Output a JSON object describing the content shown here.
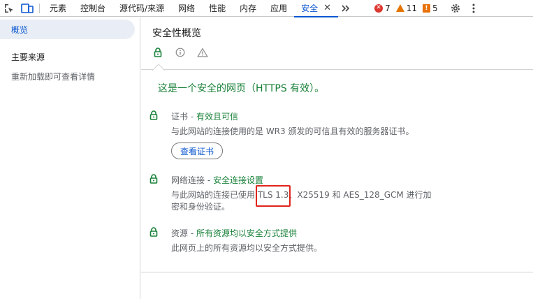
{
  "tabs": [
    {
      "label": "元素",
      "active": false
    },
    {
      "label": "控制台",
      "active": false
    },
    {
      "label": "源代码/来源",
      "active": false
    },
    {
      "label": "网络",
      "active": false
    },
    {
      "label": "性能",
      "active": false
    },
    {
      "label": "内存",
      "active": false
    },
    {
      "label": "应用",
      "active": false
    },
    {
      "label": "安全",
      "active": true
    }
  ],
  "counters": {
    "errors": "7",
    "warnings": "11",
    "issues": "5"
  },
  "icons": {
    "inspect": "inspect-element-icon",
    "device": "device-toolbar-icon",
    "more_tabs": "chevron-double-right-icon",
    "close": "close-icon",
    "settings": "gear-icon",
    "menu": "kebab-menu-icon",
    "lock": "lock-icon",
    "info": "info-icon",
    "warning": "warning-icon"
  },
  "sidebar": {
    "overview": "概览",
    "main_origin_heading": "主要来源",
    "reload_note": "重新加载即可查看详情"
  },
  "main": {
    "title": "安全性概览",
    "summary": "这是一个安全的网页（HTTPS 有效）。",
    "sections": [
      {
        "label": "证书",
        "separator": " - ",
        "value": "有效且可信",
        "desc": "与此网站的连接使用的是 WR3 颁发的可信且有效的服务器证书。",
        "button": "查看证书"
      },
      {
        "label": "网络连接",
        "separator": " - ",
        "value": "安全连接设置",
        "desc_before": "与此网站的连接已使用 ",
        "desc_highlight": "TLS 1.3",
        "desc_after": "、X25519 和 AES_128_GCM 进行加密和身份验证。"
      },
      {
        "label": "资源",
        "separator": " - ",
        "value": "所有资源均以安全方式提供",
        "desc": "此网页上的所有资源均以安全方式提供。"
      }
    ]
  },
  "colors": {
    "accent": "#0b57d0",
    "secure_green": "#188038",
    "error_red": "#dc362e",
    "warning_orange": "#e37400",
    "highlight_box": "#e0241b"
  }
}
